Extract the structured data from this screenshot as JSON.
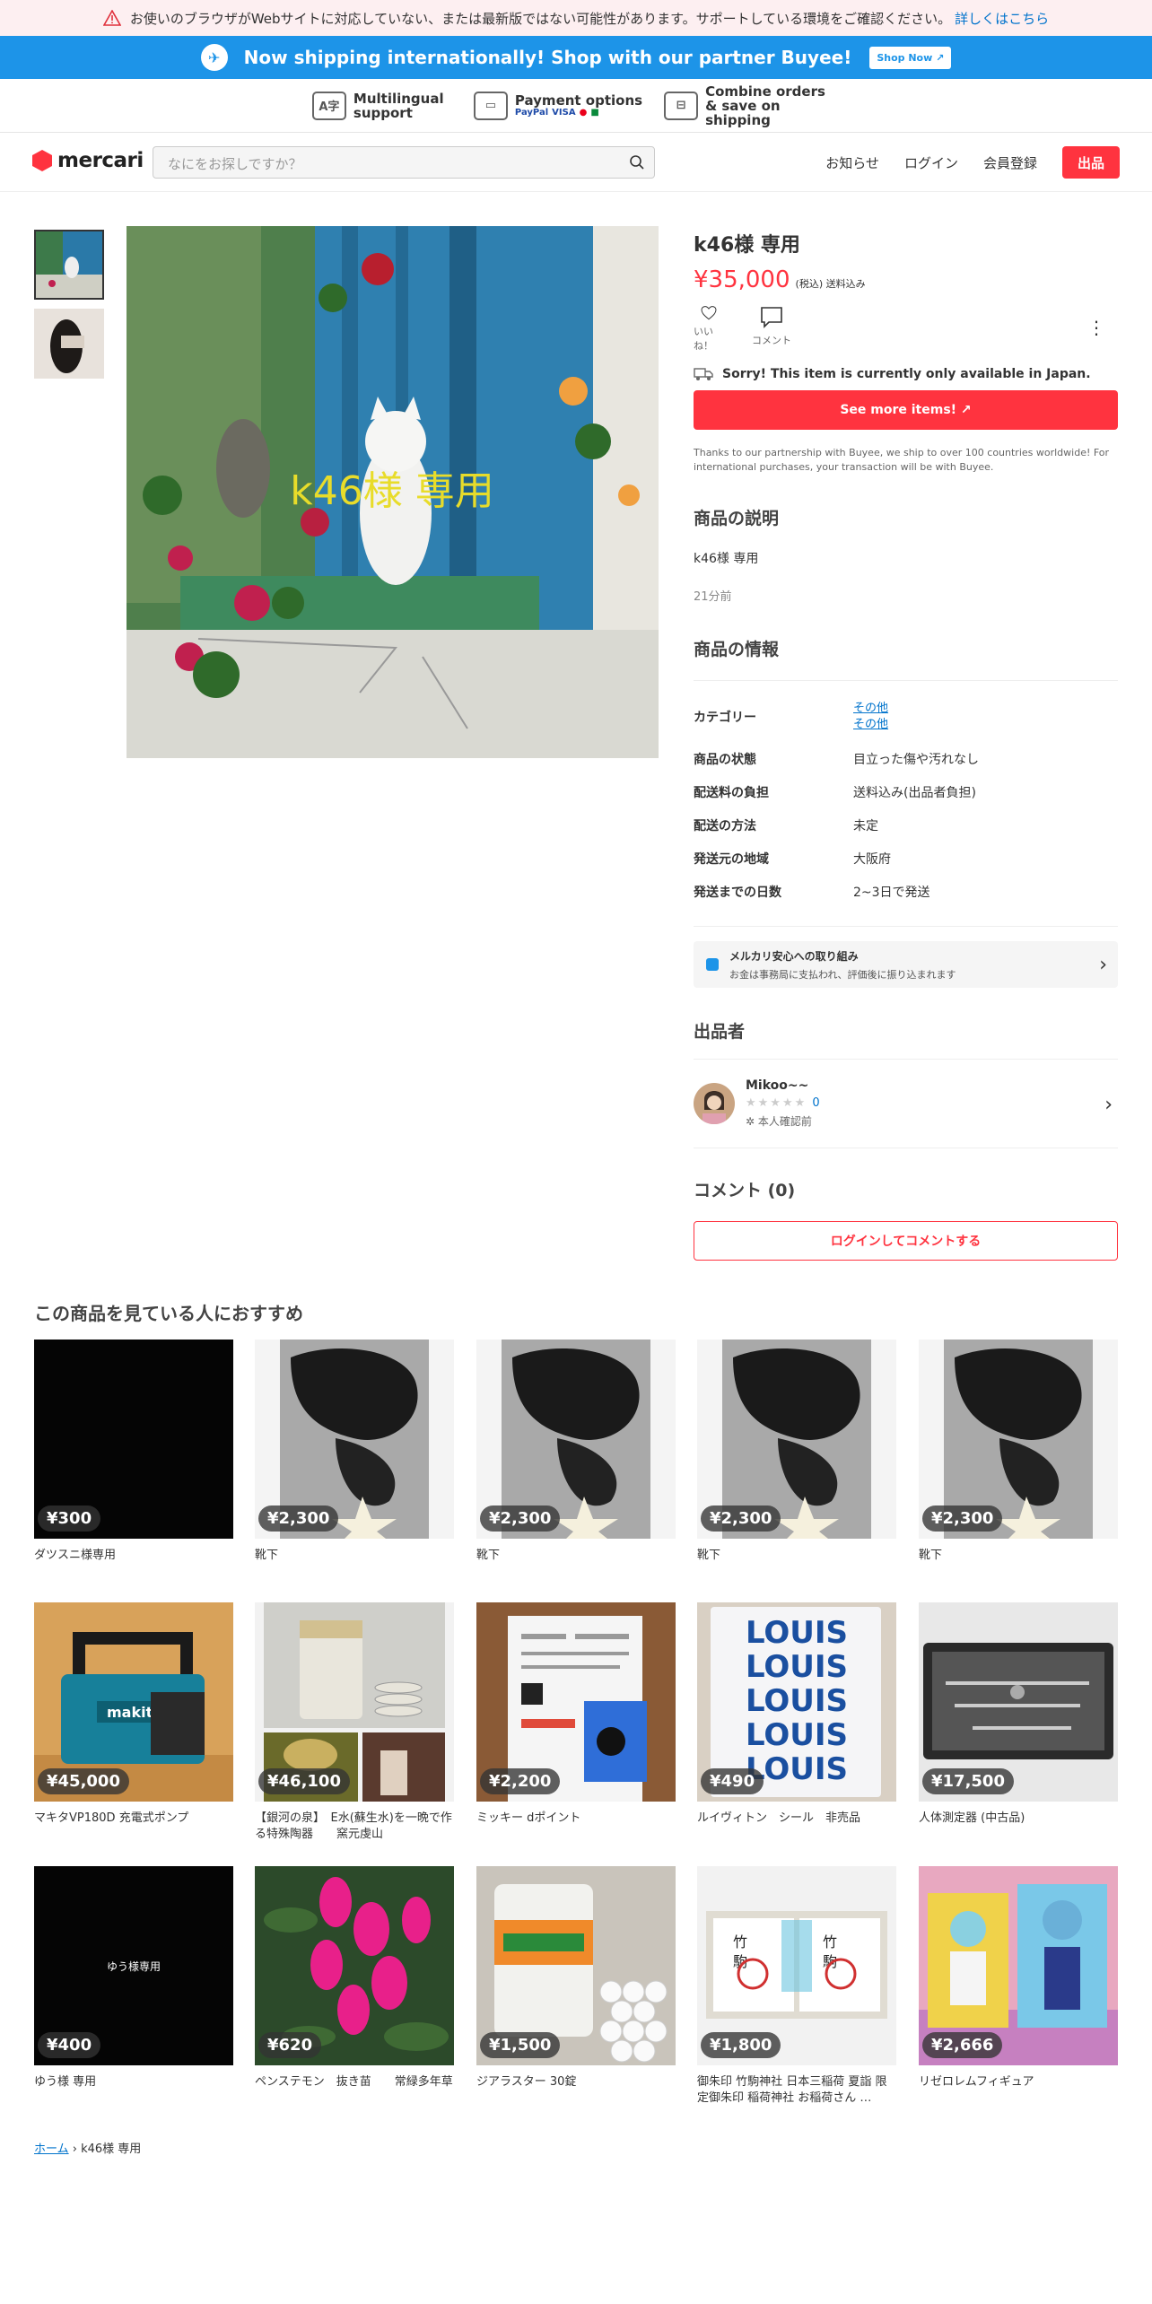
{
  "warning": {
    "text": "お使いのブラウザがWebサイトに対応していない、または最新版ではない可能性があります。サポートしている環境をご確認ください。",
    "link": "詳しくはこちら"
  },
  "shipping": {
    "text": "Now shipping internationally! Shop with our partner Buyee!",
    "button": "Shop Now"
  },
  "features": [
    {
      "icon": "translate-icon",
      "label": "Multilingual support"
    },
    {
      "icon": "card-icon",
      "label": "Payment options",
      "brands": [
        "PayPal",
        "VISA"
      ]
    },
    {
      "icon": "box-icon",
      "label": "Combine orders & save on shipping"
    }
  ],
  "header": {
    "brand": "mercari",
    "search_placeholder": "なにをお探しですか？",
    "nav": [
      "お知らせ",
      "ログイン",
      "会員登録"
    ],
    "sell": "出品"
  },
  "item": {
    "image_text": "k46様 専用",
    "title": "k46様 専用",
    "price": "¥35,000",
    "price_note": "(税込) 送料込み",
    "like": "いいね！",
    "comment": "コメント",
    "japan_only": "Sorry! This item is currently only available in Japan.",
    "see_more": "See more items!",
    "buyee_note": "Thanks to our partnership with Buyee, we ship to over 100 countries worldwide! For international purchases, your transaction will be with Buyee.",
    "desc_heading": "商品の説明",
    "desc": "k46様 専用",
    "ago": "21分前",
    "info_heading": "商品の情報",
    "category_label": "カテゴリー",
    "category_values": [
      "その他",
      "その他"
    ],
    "rows": [
      {
        "k": "商品の状態",
        "v": "目立った傷や汚れなし"
      },
      {
        "k": "配送料の負担",
        "v": "送料込み(出品者負担)"
      },
      {
        "k": "配送の方法",
        "v": "未定"
      },
      {
        "k": "発送元の地域",
        "v": "大阪府"
      },
      {
        "k": "発送までの日数",
        "v": "2~3日で発送"
      }
    ],
    "safe_title": "メルカリ安心への取り組み",
    "safe_sub": "お金は事務局に支払われ、評価後に振り込まれます",
    "seller_heading": "出品者",
    "seller_name": "Mikoo~~",
    "seller_rating": "0",
    "seller_verify": "本人確認前",
    "comments_heading": "コメント (0)",
    "comment_btn": "ログインしてコメントする"
  },
  "colors": {
    "brand": "#ff333f",
    "link": "#0073cc",
    "buyee": "#1d94e8"
  },
  "rec_heading": "この商品を見ている人におすすめ",
  "recs": [
    {
      "price": "¥300",
      "name": "ダツスニ様専用",
      "img": "black"
    },
    {
      "price": "¥2,300",
      "name": "靴下",
      "img": "sock"
    },
    {
      "price": "¥2,300",
      "name": "靴下",
      "img": "sock"
    },
    {
      "price": "¥2,300",
      "name": "靴下",
      "img": "sock"
    },
    {
      "price": "¥2,300",
      "name": "靴下",
      "img": "sock"
    },
    {
      "price": "¥45,000",
      "name": "マキタVP180D 充電式ポンプ",
      "img": "makita"
    },
    {
      "price": "¥46,100",
      "name": "【銀河の泉】　E水(蘇生水)を一晩で作る特殊陶器　　窯元虔山",
      "img": "pottery"
    },
    {
      "price": "¥2,200",
      "name": "ミッキー dポイント",
      "img": "mickey"
    },
    {
      "price": "¥490",
      "name": "ルイヴィトン　シール　非売品",
      "img": "louis"
    },
    {
      "price": "¥17,500",
      "name": "人体測定器 (中古品)",
      "img": "case"
    },
    {
      "price": "¥400",
      "name": "ゆう様 専用",
      "img": "yuu"
    },
    {
      "price": "¥620",
      "name": "ペンステモン　抜き苗　　常緑多年草",
      "img": "flower"
    },
    {
      "price": "¥1,500",
      "name": "ジアラスター 30錠",
      "img": "pills"
    },
    {
      "price": "¥1,800",
      "name": "御朱印 竹駒神社 日本三稲荷 夏詣 限定御朱印 稲荷神社 お稲荷さん …",
      "img": "goshuin"
    },
    {
      "price": "¥2,666",
      "name": "リゼロレムフィギュア",
      "img": "figure"
    }
  ],
  "louis_text": "LOUIS",
  "yuu_text": "ゆう様専用",
  "breadcrumb": {
    "home": "ホーム",
    "current": "k46様 専用"
  }
}
